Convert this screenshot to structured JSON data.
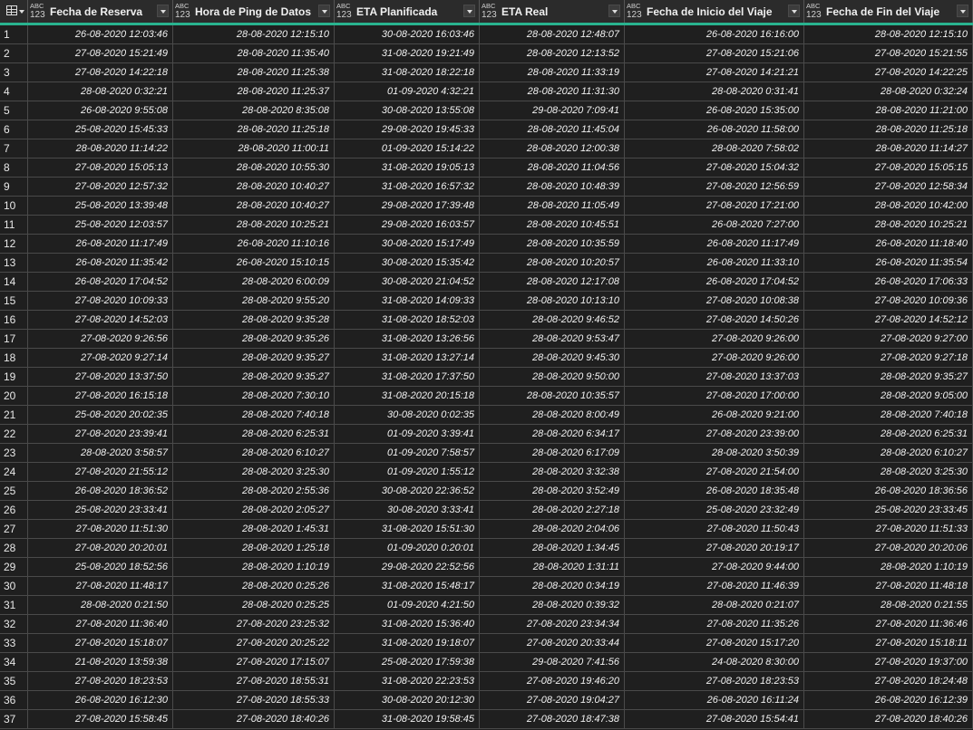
{
  "table": {
    "columns": [
      {
        "type_top": "ABC",
        "type_bottom": "123",
        "label": "Fecha de Reserva"
      },
      {
        "type_top": "ABC",
        "type_bottom": "123",
        "label": "Hora de Ping de Datos"
      },
      {
        "type_top": "ABC",
        "type_bottom": "123",
        "label": "ETA Planificada"
      },
      {
        "type_top": "ABC",
        "type_bottom": "123",
        "label": "ETA Real"
      },
      {
        "type_top": "ABC",
        "type_bottom": "123",
        "label": "Fecha de Inicio del Viaje"
      },
      {
        "type_top": "ABC",
        "type_bottom": "123",
        "label": "Fecha de Fin del Viaje"
      }
    ],
    "rows": [
      [
        "1",
        "26-08-2020 12:03:46",
        "28-08-2020 12:15:10",
        "30-08-2020 16:03:46",
        "28-08-2020 12:48:07",
        "26-08-2020 16:16:00",
        "28-08-2020 12:15:10"
      ],
      [
        "2",
        "27-08-2020 15:21:49",
        "28-08-2020 11:35:40",
        "31-08-2020 19:21:49",
        "28-08-2020 12:13:52",
        "27-08-2020 15:21:06",
        "27-08-2020 15:21:55"
      ],
      [
        "3",
        "27-08-2020 14:22:18",
        "28-08-2020 11:25:38",
        "31-08-2020 18:22:18",
        "28-08-2020 11:33:19",
        "27-08-2020 14:21:21",
        "27-08-2020 14:22:25"
      ],
      [
        "4",
        "28-08-2020 0:32:21",
        "28-08-2020 11:25:37",
        "01-09-2020 4:32:21",
        "28-08-2020 11:31:30",
        "28-08-2020 0:31:41",
        "28-08-2020 0:32:24"
      ],
      [
        "5",
        "26-08-2020 9:55:08",
        "28-08-2020 8:35:08",
        "30-08-2020 13:55:08",
        "29-08-2020 7:09:41",
        "26-08-2020 15:35:00",
        "28-08-2020 11:21:00"
      ],
      [
        "6",
        "25-08-2020 15:45:33",
        "28-08-2020 11:25:18",
        "29-08-2020 19:45:33",
        "28-08-2020 11:45:04",
        "26-08-2020 11:58:00",
        "28-08-2020 11:25:18"
      ],
      [
        "7",
        "28-08-2020 11:14:22",
        "28-08-2020 11:00:11",
        "01-09-2020 15:14:22",
        "28-08-2020 12:00:38",
        "28-08-2020 7:58:02",
        "28-08-2020 11:14:27"
      ],
      [
        "8",
        "27-08-2020 15:05:13",
        "28-08-2020 10:55:30",
        "31-08-2020 19:05:13",
        "28-08-2020 11:04:56",
        "27-08-2020 15:04:32",
        "27-08-2020 15:05:15"
      ],
      [
        "9",
        "27-08-2020 12:57:32",
        "28-08-2020 10:40:27",
        "31-08-2020 16:57:32",
        "28-08-2020 10:48:39",
        "27-08-2020 12:56:59",
        "27-08-2020 12:58:34"
      ],
      [
        "10",
        "25-08-2020 13:39:48",
        "28-08-2020 10:40:27",
        "29-08-2020 17:39:48",
        "28-08-2020 11:05:49",
        "27-08-2020 17:21:00",
        "28-08-2020 10:42:00"
      ],
      [
        "11",
        "25-08-2020 12:03:57",
        "28-08-2020 10:25:21",
        "29-08-2020 16:03:57",
        "28-08-2020 10:45:51",
        "26-08-2020 7:27:00",
        "28-08-2020 10:25:21"
      ],
      [
        "12",
        "26-08-2020 11:17:49",
        "26-08-2020 11:10:16",
        "30-08-2020 15:17:49",
        "28-08-2020 10:35:59",
        "26-08-2020 11:17:49",
        "26-08-2020 11:18:40"
      ],
      [
        "13",
        "26-08-2020 11:35:42",
        "26-08-2020 15:10:15",
        "30-08-2020 15:35:42",
        "28-08-2020 10:20:57",
        "26-08-2020 11:33:10",
        "26-08-2020 11:35:54"
      ],
      [
        "14",
        "26-08-2020 17:04:52",
        "28-08-2020 6:00:09",
        "30-08-2020 21:04:52",
        "28-08-2020 12:17:08",
        "26-08-2020 17:04:52",
        "26-08-2020 17:06:33"
      ],
      [
        "15",
        "27-08-2020 10:09:33",
        "28-08-2020 9:55:20",
        "31-08-2020 14:09:33",
        "28-08-2020 10:13:10",
        "27-08-2020 10:08:38",
        "27-08-2020 10:09:36"
      ],
      [
        "16",
        "27-08-2020 14:52:03",
        "28-08-2020 9:35:28",
        "31-08-2020 18:52:03",
        "28-08-2020 9:46:52",
        "27-08-2020 14:50:26",
        "27-08-2020 14:52:12"
      ],
      [
        "17",
        "27-08-2020 9:26:56",
        "28-08-2020 9:35:26",
        "31-08-2020 13:26:56",
        "28-08-2020 9:53:47",
        "27-08-2020 9:26:00",
        "27-08-2020 9:27:00"
      ],
      [
        "18",
        "27-08-2020 9:27:14",
        "28-08-2020 9:35:27",
        "31-08-2020 13:27:14",
        "28-08-2020 9:45:30",
        "27-08-2020 9:26:00",
        "27-08-2020 9:27:18"
      ],
      [
        "19",
        "27-08-2020 13:37:50",
        "28-08-2020 9:35:27",
        "31-08-2020 17:37:50",
        "28-08-2020 9:50:00",
        "27-08-2020 13:37:03",
        "28-08-2020 9:35:27"
      ],
      [
        "20",
        "27-08-2020 16:15:18",
        "28-08-2020 7:30:10",
        "31-08-2020 20:15:18",
        "28-08-2020 10:35:57",
        "27-08-2020 17:00:00",
        "28-08-2020 9:05:00"
      ],
      [
        "21",
        "25-08-2020 20:02:35",
        "28-08-2020 7:40:18",
        "30-08-2020 0:02:35",
        "28-08-2020 8:00:49",
        "26-08-2020 9:21:00",
        "28-08-2020 7:40:18"
      ],
      [
        "22",
        "27-08-2020 23:39:41",
        "28-08-2020 6:25:31",
        "01-09-2020 3:39:41",
        "28-08-2020 6:34:17",
        "27-08-2020 23:39:00",
        "28-08-2020 6:25:31"
      ],
      [
        "23",
        "28-08-2020 3:58:57",
        "28-08-2020 6:10:27",
        "01-09-2020 7:58:57",
        "28-08-2020 6:17:09",
        "28-08-2020 3:50:39",
        "28-08-2020 6:10:27"
      ],
      [
        "24",
        "27-08-2020 21:55:12",
        "28-08-2020 3:25:30",
        "01-09-2020 1:55:12",
        "28-08-2020 3:32:38",
        "27-08-2020 21:54:00",
        "28-08-2020 3:25:30"
      ],
      [
        "25",
        "26-08-2020 18:36:52",
        "28-08-2020 2:55:36",
        "30-08-2020 22:36:52",
        "28-08-2020 3:52:49",
        "26-08-2020 18:35:48",
        "26-08-2020 18:36:56"
      ],
      [
        "26",
        "25-08-2020 23:33:41",
        "28-08-2020 2:05:27",
        "30-08-2020 3:33:41",
        "28-08-2020 2:27:18",
        "25-08-2020 23:32:49",
        "25-08-2020 23:33:45"
      ],
      [
        "27",
        "27-08-2020 11:51:30",
        "28-08-2020 1:45:31",
        "31-08-2020 15:51:30",
        "28-08-2020 2:04:06",
        "27-08-2020 11:50:43",
        "27-08-2020 11:51:33"
      ],
      [
        "28",
        "27-08-2020 20:20:01",
        "28-08-2020 1:25:18",
        "01-09-2020 0:20:01",
        "28-08-2020 1:34:45",
        "27-08-2020 20:19:17",
        "27-08-2020 20:20:06"
      ],
      [
        "29",
        "25-08-2020 18:52:56",
        "28-08-2020 1:10:19",
        "29-08-2020 22:52:56",
        "28-08-2020 1:31:11",
        "27-08-2020 9:44:00",
        "28-08-2020 1:10:19"
      ],
      [
        "30",
        "27-08-2020 11:48:17",
        "28-08-2020 0:25:26",
        "31-08-2020 15:48:17",
        "28-08-2020 0:34:19",
        "27-08-2020 11:46:39",
        "27-08-2020 11:48:18"
      ],
      [
        "31",
        "28-08-2020 0:21:50",
        "28-08-2020 0:25:25",
        "01-09-2020 4:21:50",
        "28-08-2020 0:39:32",
        "28-08-2020 0:21:07",
        "28-08-2020 0:21:55"
      ],
      [
        "32",
        "27-08-2020 11:36:40",
        "27-08-2020 23:25:32",
        "31-08-2020 15:36:40",
        "27-08-2020 23:34:34",
        "27-08-2020 11:35:26",
        "27-08-2020 11:36:46"
      ],
      [
        "33",
        "27-08-2020 15:18:07",
        "27-08-2020 20:25:22",
        "31-08-2020 19:18:07",
        "27-08-2020 20:33:44",
        "27-08-2020 15:17:20",
        "27-08-2020 15:18:11"
      ],
      [
        "34",
        "21-08-2020 13:59:38",
        "27-08-2020 17:15:07",
        "25-08-2020 17:59:38",
        "29-08-2020 7:41:56",
        "24-08-2020 8:30:00",
        "27-08-2020 19:37:00"
      ],
      [
        "35",
        "27-08-2020 18:23:53",
        "27-08-2020 18:55:31",
        "31-08-2020 22:23:53",
        "27-08-2020 19:46:20",
        "27-08-2020 18:23:53",
        "27-08-2020 18:24:48"
      ],
      [
        "36",
        "26-08-2020 16:12:30",
        "27-08-2020 18:55:33",
        "30-08-2020 20:12:30",
        "27-08-2020 19:04:27",
        "26-08-2020 16:11:24",
        "26-08-2020 16:12:39"
      ],
      [
        "37",
        "27-08-2020 15:58:45",
        "27-08-2020 18:40:26",
        "31-08-2020 19:58:45",
        "27-08-2020 18:47:38",
        "27-08-2020 15:54:41",
        "27-08-2020 18:40:26"
      ]
    ]
  }
}
